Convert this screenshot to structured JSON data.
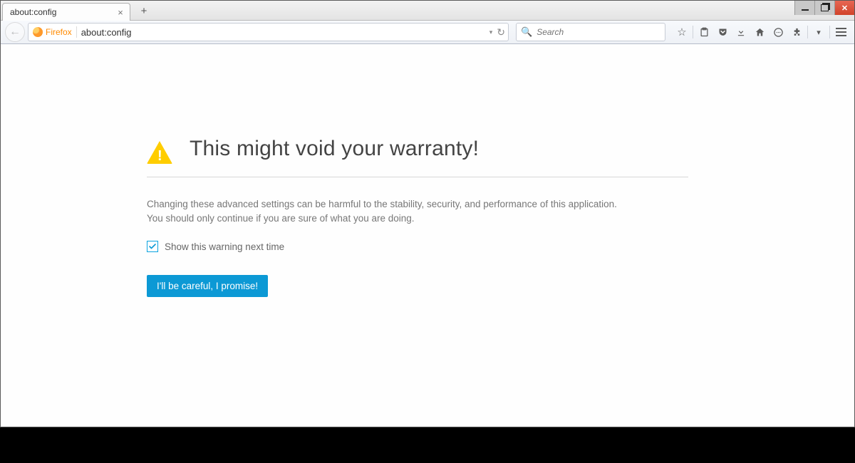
{
  "tab": {
    "title": "about:config"
  },
  "url": {
    "identity": "Firefox",
    "value": "about:config"
  },
  "search": {
    "placeholder": "Search"
  },
  "warning": {
    "heading": "This might void your warranty!",
    "body": "Changing these advanced settings can be harmful to the stability, security, and performance of this application. You should only continue if you are sure of what you are doing.",
    "checkbox_label": "Show this warning next time",
    "checkbox_checked": true,
    "accept_label": "I'll be careful, I promise!"
  },
  "toolbar_icons": {
    "back": "←",
    "star": "☆",
    "clipboard": "📋",
    "pocket": "⌄",
    "download": "⬇",
    "home": "⌂",
    "chat": "💬",
    "addon": "✦",
    "dropdown": "▾",
    "reload": "↻",
    "dd": "▾"
  }
}
